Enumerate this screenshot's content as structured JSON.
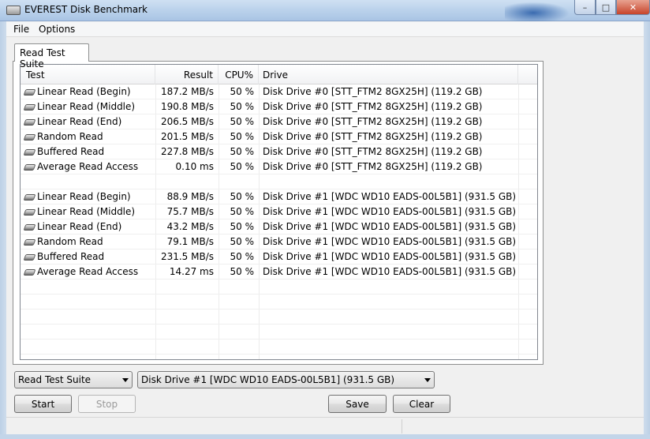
{
  "window": {
    "title": "EVEREST Disk Benchmark",
    "minimize_glyph": "–",
    "maximize_glyph": "□",
    "close_glyph": "✕"
  },
  "menu": {
    "file": "File",
    "options": "Options"
  },
  "tab": {
    "label": "Read Test Suite"
  },
  "table": {
    "columns": [
      "Test",
      "Result",
      "CPU%",
      "Drive"
    ],
    "rows": [
      {
        "icon": "hard-drive-icon",
        "test": "Linear Read (Begin)",
        "result": "187.2 MB/s",
        "cpu": "50 %",
        "drive": "Disk Drive #0  [STT_FTM2 8GX25H]  (119.2 GB)"
      },
      {
        "icon": "hard-drive-icon",
        "test": "Linear Read (Middle)",
        "result": "190.8 MB/s",
        "cpu": "50 %",
        "drive": "Disk Drive #0  [STT_FTM2 8GX25H]  (119.2 GB)"
      },
      {
        "icon": "hard-drive-icon",
        "test": "Linear Read (End)",
        "result": "206.5 MB/s",
        "cpu": "50 %",
        "drive": "Disk Drive #0  [STT_FTM2 8GX25H]  (119.2 GB)"
      },
      {
        "icon": "hard-drive-icon",
        "test": "Random Read",
        "result": "201.5 MB/s",
        "cpu": "50 %",
        "drive": "Disk Drive #0  [STT_FTM2 8GX25H]  (119.2 GB)"
      },
      {
        "icon": "hard-drive-icon",
        "test": "Buffered Read",
        "result": "227.8 MB/s",
        "cpu": "50 %",
        "drive": "Disk Drive #0  [STT_FTM2 8GX25H]  (119.2 GB)"
      },
      {
        "icon": "hard-drive-icon",
        "test": "Average Read Access",
        "result": "0.10 ms",
        "cpu": "50 %",
        "drive": "Disk Drive #0  [STT_FTM2 8GX25H]  (119.2 GB)"
      },
      {
        "icon": "",
        "test": "",
        "result": "",
        "cpu": "",
        "drive": ""
      },
      {
        "icon": "hard-drive-icon",
        "test": "Linear Read (Begin)",
        "result": "88.9 MB/s",
        "cpu": "50 %",
        "drive": "Disk Drive #1  [WDC WD10 EADS-00L5B1]  (931.5 GB)"
      },
      {
        "icon": "hard-drive-icon",
        "test": "Linear Read (Middle)",
        "result": "75.7 MB/s",
        "cpu": "50 %",
        "drive": "Disk Drive #1  [WDC WD10 EADS-00L5B1]  (931.5 GB)"
      },
      {
        "icon": "hard-drive-icon",
        "test": "Linear Read (End)",
        "result": "43.2 MB/s",
        "cpu": "50 %",
        "drive": "Disk Drive #1  [WDC WD10 EADS-00L5B1]  (931.5 GB)"
      },
      {
        "icon": "hard-drive-icon",
        "test": "Random Read",
        "result": "79.1 MB/s",
        "cpu": "50 %",
        "drive": "Disk Drive #1  [WDC WD10 EADS-00L5B1]  (931.5 GB)"
      },
      {
        "icon": "hard-drive-icon",
        "test": "Buffered Read",
        "result": "231.5 MB/s",
        "cpu": "50 %",
        "drive": "Disk Drive #1  [WDC WD10 EADS-00L5B1]  (931.5 GB)"
      },
      {
        "icon": "hard-drive-icon",
        "test": "Average Read Access",
        "result": "14.27 ms",
        "cpu": "50 %",
        "drive": "Disk Drive #1  [WDC WD10 EADS-00L5B1]  (931.5 GB)"
      }
    ]
  },
  "controls": {
    "suite_selected": "Read Test Suite",
    "drive_selected": "Disk Drive #1  [WDC WD10 EADS-00L5B1]  (931.5 GB)",
    "start_label": "Start",
    "stop_label": "Stop",
    "save_label": "Save",
    "clear_label": "Clear"
  }
}
